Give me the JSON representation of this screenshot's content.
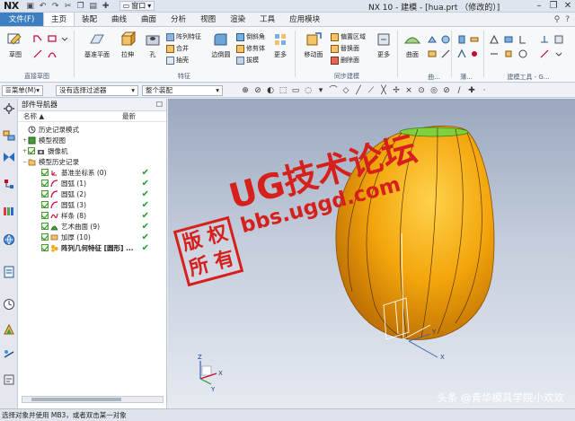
{
  "titlebar": {
    "logo": "NX",
    "window_menu": "窗口",
    "title": "NX 10 - 建模 - [hua.prt （修改的）]",
    "minimize": "–",
    "restore": "❐",
    "close": "✕"
  },
  "tabs": {
    "file": "文件(F)",
    "items": [
      "主页",
      "装配",
      "曲线",
      "曲面",
      "分析",
      "视图",
      "渲染",
      "工具",
      "应用模块"
    ]
  },
  "ribbon": {
    "sketch": "草图",
    "direct_sketch": "直接草图",
    "datum_plane": "基准平面",
    "extrude": "拉伸",
    "hole": "孔",
    "feature_group": "特征",
    "array_feature": "阵列特征",
    "combine": "合并",
    "shell": "抽壳",
    "edge_blend": "边倒圆",
    "chamfer": "倒斜角",
    "trim_body": "修剪体",
    "draft": "拔模",
    "more": "更多",
    "move_face": "移动面",
    "offset_region": "偏置区域",
    "replace_face": "替换面",
    "delete_face": "删除面",
    "sync_group": "同步建模",
    "more2": "更多",
    "surface": "曲面",
    "surface_group": "曲...",
    "sheet_group": "薄...",
    "std_parts_group": "建模工具 - G..."
  },
  "selbar": {
    "menu": "菜单(M)",
    "filter": "没有选择过滤器",
    "scope": "整个装配"
  },
  "navigator": {
    "title": "部件导航器",
    "col_name": "名称",
    "col_latest": "最新",
    "rows": [
      {
        "label": "历史记录模式",
        "kind": "mode"
      },
      {
        "label": "模型视图",
        "kind": "view"
      },
      {
        "label": "摄像机",
        "kind": "camera"
      },
      {
        "label": "模型历史记录",
        "kind": "history"
      },
      {
        "label": "基准坐标系 (0)",
        "kind": "feat",
        "tick": "✔"
      },
      {
        "label": "圆弧 (1)",
        "kind": "feat",
        "tick": "✔"
      },
      {
        "label": "圆弧 (2)",
        "kind": "feat",
        "tick": "✔"
      },
      {
        "label": "圆弧 (3)",
        "kind": "feat",
        "tick": "✔"
      },
      {
        "label": "样条 (8)",
        "kind": "feat",
        "tick": "✔"
      },
      {
        "label": "艺术曲面 (9)",
        "kind": "feat",
        "tick": "✔"
      },
      {
        "label": "加厚 (10)",
        "kind": "feat",
        "tick": "✔"
      },
      {
        "label": "阵列几何特征 [圆形] ...",
        "kind": "feat",
        "tick": "✔"
      }
    ]
  },
  "viewport": {
    "axis_x": "X",
    "axis_y": "Y",
    "axis_z": "Z"
  },
  "watermark": {
    "line1": "UG技术论坛",
    "line2": "bbs.uggd.com",
    "seal": [
      "版",
      "权",
      "所",
      "有"
    ],
    "credit": "头条 @青华模具学院小欢欢"
  },
  "status": "选择对象并使用 MB3，或者双击某一对象",
  "colors": {
    "accent": "#3c7fc1",
    "body_orange": "#f3a60c",
    "rim_green": "#7fd13b",
    "watermark_red": "#d6201b"
  }
}
